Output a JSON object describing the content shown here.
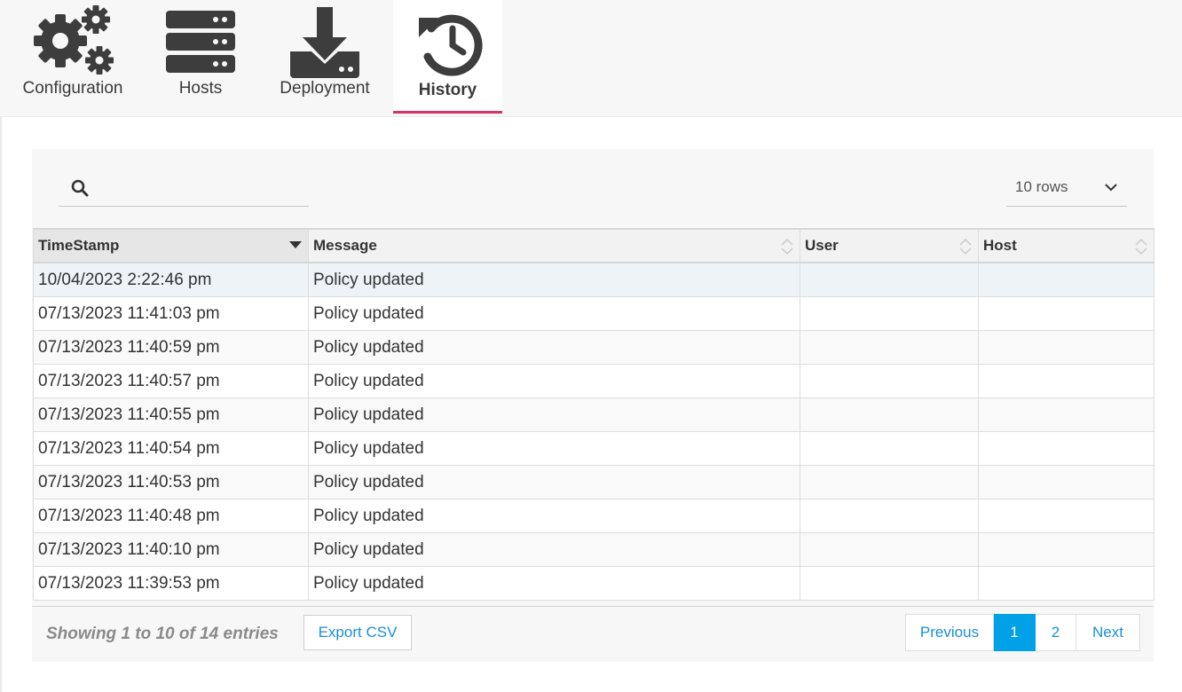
{
  "toolbar": {
    "tabs": [
      {
        "label": "Configuration",
        "icon": "gears-icon"
      },
      {
        "label": "Hosts",
        "icon": "server-icon"
      },
      {
        "label": "Deployment",
        "icon": "download-icon"
      },
      {
        "label": "History",
        "icon": "history-icon",
        "active": true
      }
    ],
    "accent_color": "#d3336c"
  },
  "search": {
    "value": "",
    "placeholder": ""
  },
  "rows_select": {
    "value": "10 rows"
  },
  "table": {
    "columns": [
      "TimeStamp",
      "Message",
      "User",
      "Host"
    ],
    "rows": [
      {
        "timestamp": "10/04/2023 2:22:46 pm",
        "message": "Policy updated",
        "user": "",
        "host": ""
      },
      {
        "timestamp": "07/13/2023 11:41:03 pm",
        "message": "Policy updated",
        "user": "",
        "host": ""
      },
      {
        "timestamp": "07/13/2023 11:40:59 pm",
        "message": "Policy updated",
        "user": "",
        "host": ""
      },
      {
        "timestamp": "07/13/2023 11:40:57 pm",
        "message": "Policy updated",
        "user": "",
        "host": ""
      },
      {
        "timestamp": "07/13/2023 11:40:55 pm",
        "message": "Policy updated",
        "user": "",
        "host": ""
      },
      {
        "timestamp": "07/13/2023 11:40:54 pm",
        "message": "Policy updated",
        "user": "",
        "host": ""
      },
      {
        "timestamp": "07/13/2023 11:40:53 pm",
        "message": "Policy updated",
        "user": "",
        "host": ""
      },
      {
        "timestamp": "07/13/2023 11:40:48 pm",
        "message": "Policy updated",
        "user": "",
        "host": ""
      },
      {
        "timestamp": "07/13/2023 11:40:10 pm",
        "message": "Policy updated",
        "user": "",
        "host": ""
      },
      {
        "timestamp": "07/13/2023 11:39:53 pm",
        "message": "Policy updated",
        "user": "",
        "host": ""
      }
    ]
  },
  "footer": {
    "info": "Showing 1 to 10 of 14 entries",
    "export_label": "Export CSV",
    "pagination": {
      "previous": "Previous",
      "pages": [
        "1",
        "2"
      ],
      "current": "1",
      "next": "Next"
    },
    "active_color": "#00a1e6"
  }
}
